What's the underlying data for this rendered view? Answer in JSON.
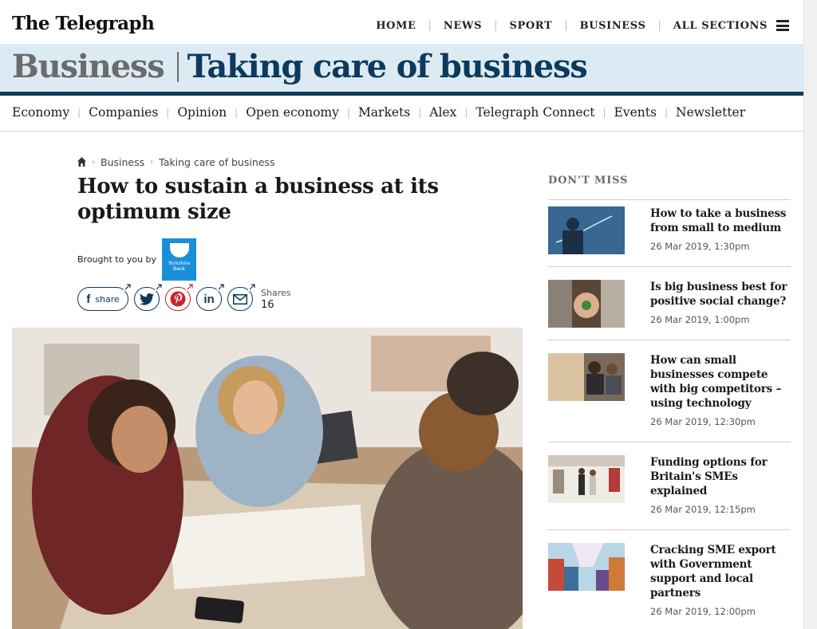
{
  "brand": {
    "logo": "The Telegraph",
    "navy": "#0d3a5c",
    "band_bg": "#dcebf3"
  },
  "topnav": [
    {
      "label": "HOME"
    },
    {
      "label": "NEWS"
    },
    {
      "label": "SPORT"
    },
    {
      "label": "BUSINESS"
    },
    {
      "label": "ALL SECTIONS"
    }
  ],
  "menu_icon": "hamburger-menu-icon",
  "section": {
    "name": "Business",
    "subtitle": "Taking care of business"
  },
  "subnav": [
    {
      "label": "Economy"
    },
    {
      "label": "Companies"
    },
    {
      "label": "Opinion"
    },
    {
      "label": "Open economy"
    },
    {
      "label": "Markets"
    },
    {
      "label": "Alex"
    },
    {
      "label": "Telegraph Connect"
    },
    {
      "label": "Events"
    },
    {
      "label": "Newsletter"
    }
  ],
  "breadcrumb": {
    "home_icon": "home-icon",
    "items": [
      "Business",
      "Taking care of business"
    ]
  },
  "article": {
    "headline": "How to sustain a business at its optimum size",
    "brought_to_you_by": "Brought to you by",
    "sponsor": "Yorkshire Bank",
    "share_label": "share",
    "shares_label": "Shares",
    "shares_count": "16",
    "share_icons": [
      "facebook-icon",
      "twitter-icon",
      "pinterest-icon",
      "linkedin-icon",
      "email-icon"
    ]
  },
  "dont_miss": {
    "title": "DON’T MISS",
    "items": [
      {
        "headline": "How to take a business from small to medium",
        "date": "26 Mar 2019, 1:30pm"
      },
      {
        "headline": "Is big business best for positive social change?",
        "date": "26 Mar 2019, 1:00pm"
      },
      {
        "headline": "How can small businesses compete with big competitors – using technology",
        "date": "26 Mar 2019, 12:30pm"
      },
      {
        "headline": "Funding options for Britain's SMEs explained",
        "date": "26 Mar 2019, 12:15pm"
      },
      {
        "headline": "Cracking SME export with Government support and local partners",
        "date": "26 Mar 2019, 12:00pm"
      }
    ]
  }
}
